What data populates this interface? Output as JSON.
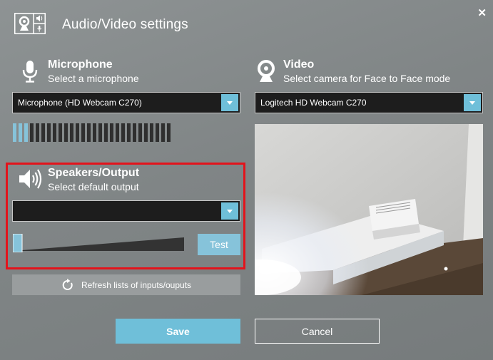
{
  "dialog": {
    "title": "Audio/Video settings",
    "close_icon": "close-icon",
    "logo_icon": "audio-video-settings-icon"
  },
  "microphone": {
    "title": "Microphone",
    "subtitle": "Select a microphone",
    "icon": "microphone-icon",
    "selected": "Microphone (HD Webcam C270)",
    "level": {
      "segments_total": 28,
      "segments_active": 3
    }
  },
  "speakers": {
    "title": "Speakers/Output",
    "subtitle": "Select default output",
    "icon": "speaker-icon",
    "selected": "",
    "volume": 0,
    "test_label": "Test"
  },
  "refresh": {
    "label": "Refresh lists of inputs/ouputs",
    "icon": "refresh-icon"
  },
  "video": {
    "title": "Video",
    "subtitle": "Select camera for Face to Face mode",
    "icon": "webcam-icon",
    "selected": "Logitech HD Webcam C270"
  },
  "footer": {
    "save_label": "Save",
    "cancel_label": "Cancel"
  },
  "colors": {
    "accent": "#6fbfd9",
    "meter_active": "#86c3da",
    "highlight": "#e3131b",
    "dropdown_bg": "#1d1d1d"
  }
}
